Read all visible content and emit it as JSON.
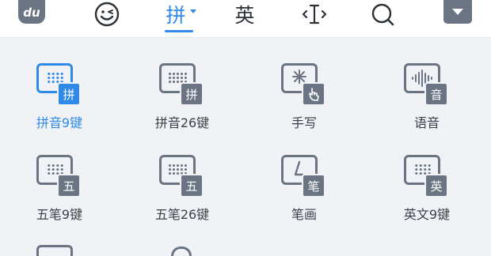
{
  "toolbar": {
    "logo_text": "du",
    "emoji_icon": "smile-icon",
    "pinyin_label": "拼",
    "english_label": "英",
    "cursor_icon": "text-cursor-icon",
    "search_icon": "search-icon",
    "menu_icon": "dropdown-icon",
    "active_color": "#2e8ae6"
  },
  "keyboards": [
    {
      "label": "拼音9键",
      "badge": "拼",
      "icon": "keyboard-9key-icon",
      "active": true
    },
    {
      "label": "拼音26键",
      "badge": "拼",
      "icon": "keyboard-26key-icon",
      "active": false
    },
    {
      "label": "手写",
      "badge": "",
      "icon": "handwriting-icon",
      "active": false
    },
    {
      "label": "语音",
      "badge": "音",
      "icon": "voice-icon",
      "active": false
    },
    {
      "label": "五笔9键",
      "badge": "五",
      "icon": "keyboard-9key-icon",
      "active": false
    },
    {
      "label": "五笔26键",
      "badge": "五",
      "icon": "keyboard-26key-icon",
      "active": false
    },
    {
      "label": "笔画",
      "badge": "笔",
      "icon": "stroke-icon",
      "active": false
    },
    {
      "label": "英文9键",
      "badge": "英",
      "icon": "keyboard-9key-icon",
      "active": false
    }
  ]
}
